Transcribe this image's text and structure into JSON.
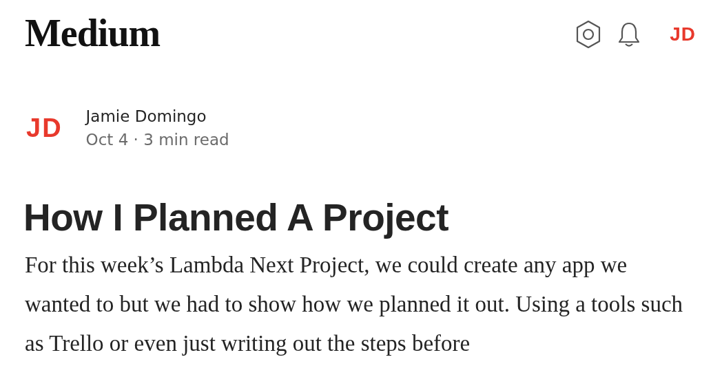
{
  "header": {
    "logo": "Medium",
    "user_initials": "JD"
  },
  "author": {
    "initials": "JD",
    "name": "Jamie Domingo",
    "meta": "Oct 4 · 3 min read"
  },
  "article": {
    "title": "How I Planned A Project",
    "body": "For this week’s Lambda Next Project, we could create any app we wanted to but we had to show how we planned it out. Using a tools such as Trello or even just writing out the steps before"
  }
}
